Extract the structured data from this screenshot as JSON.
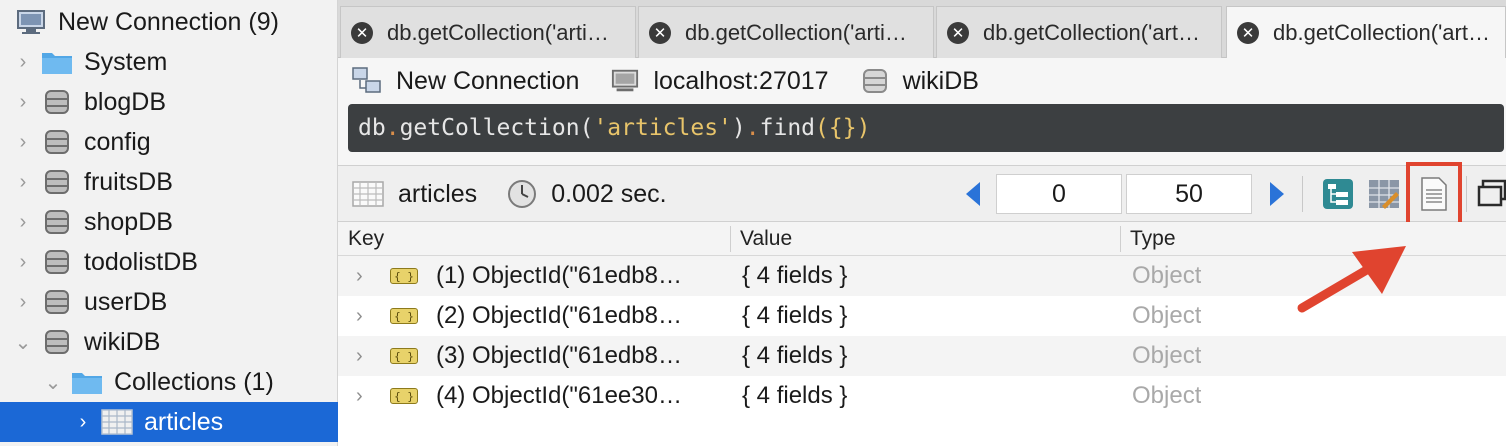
{
  "sidebar": {
    "connection": {
      "label": "New Connection (9)",
      "icon": "monitor-icon"
    },
    "items": [
      {
        "label": "System",
        "icon": "folder-icon",
        "expanded": false
      },
      {
        "label": "blogDB",
        "icon": "database-icon",
        "expanded": false
      },
      {
        "label": "config",
        "icon": "database-icon",
        "expanded": false
      },
      {
        "label": "fruitsDB",
        "icon": "database-icon",
        "expanded": false
      },
      {
        "label": "shopDB",
        "icon": "database-icon",
        "expanded": false
      },
      {
        "label": "todolistDB",
        "icon": "database-icon",
        "expanded": false
      },
      {
        "label": "userDB",
        "icon": "database-icon",
        "expanded": false
      },
      {
        "label": "wikiDB",
        "icon": "database-icon",
        "expanded": true
      }
    ],
    "collections": {
      "label": "Collections (1)",
      "icon": "folder-icon",
      "expanded": true
    },
    "selected": {
      "label": "articles",
      "icon": "collection-icon"
    }
  },
  "tabs": [
    {
      "label": "db.getCollection('arti…",
      "active": false
    },
    {
      "label": "db.getCollection('arti…",
      "active": false
    },
    {
      "label": "db.getCollection('art…",
      "active": false
    },
    {
      "label": "db.getCollection('art…",
      "active": true
    }
  ],
  "connbar": {
    "connection": "New Connection",
    "host": "localhost:27017",
    "database": "wikiDB"
  },
  "query": {
    "prefix": "db",
    "dot1": ".",
    "method": "getCollection",
    "open1": "(",
    "arg": "'articles'",
    "close1": ")",
    "dot2": ".",
    "method2": "find",
    "open2": "(",
    "braces": "{}",
    "close2": ")"
  },
  "results": {
    "collection": "articles",
    "time": "0.002 sec.",
    "skip": "0",
    "limit": "50"
  },
  "table": {
    "headers": {
      "key": "Key",
      "value": "Value",
      "type": "Type"
    },
    "rows": [
      {
        "key": "(1) ObjectId(\"61edb8…",
        "value": "{ 4 fields }",
        "type": "Object"
      },
      {
        "key": "(2) ObjectId(\"61edb8…",
        "value": "{ 4 fields }",
        "type": "Object"
      },
      {
        "key": "(3) ObjectId(\"61edb8…",
        "value": "{ 4 fields }",
        "type": "Object"
      },
      {
        "key": "(4) ObjectId(\"61ee30…",
        "value": "{ 4 fields }",
        "type": "Object"
      }
    ]
  },
  "colors": {
    "selection": "#1b68d6",
    "highlight": "#e0442f",
    "query_bg": "#3c3f41",
    "string": "#e8c46a"
  }
}
